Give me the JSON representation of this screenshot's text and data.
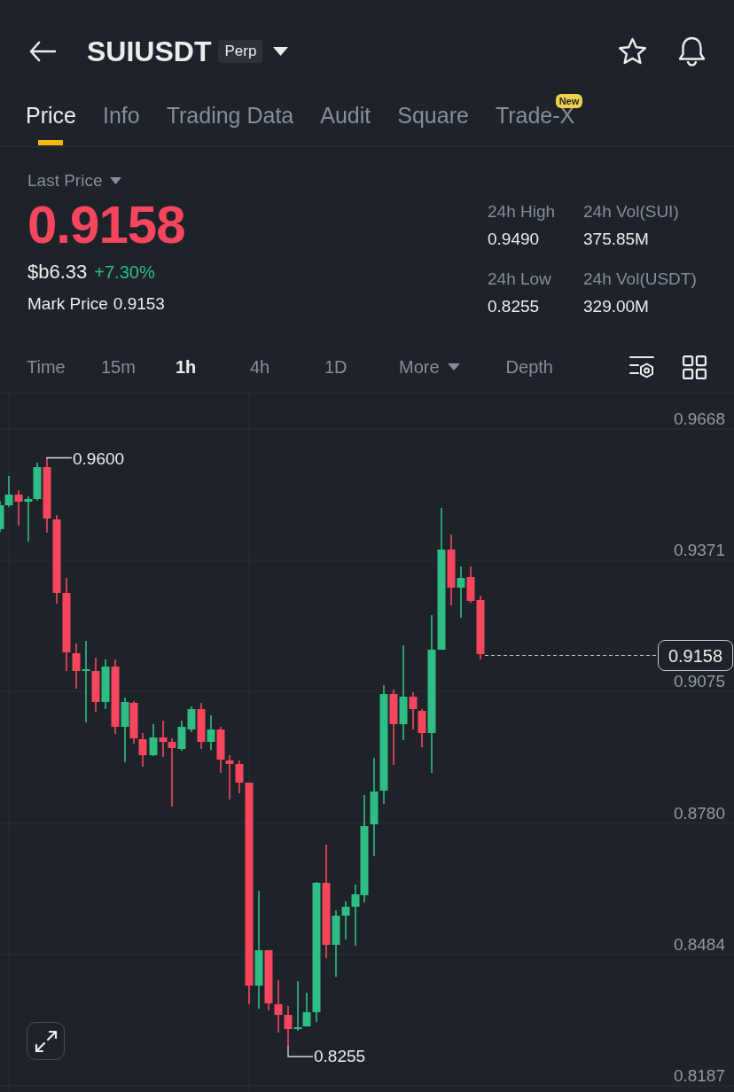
{
  "header": {
    "symbol": "SUIUSDT",
    "contract_badge": "Perp"
  },
  "tabs": [
    {
      "label": "Price",
      "selected": true
    },
    {
      "label": "Info",
      "selected": false
    },
    {
      "label": "Trading Data",
      "selected": false
    },
    {
      "label": "Audit",
      "selected": false
    },
    {
      "label": "Square",
      "selected": false
    },
    {
      "label": "Trade-X",
      "selected": false,
      "badge": "New"
    }
  ],
  "price": {
    "label": "Last Price",
    "last_price": "0.9158",
    "last_price_down": true,
    "fiat_value": "$b6.33",
    "change": "+7.30%",
    "change_up": true,
    "mark_price_label": "Mark Price",
    "mark_price": "0.9153"
  },
  "stats": [
    {
      "label": "24h High",
      "value": "0.9490"
    },
    {
      "label": "24h Vol(SUI)",
      "value": "375.85M"
    },
    {
      "label": "24h Low",
      "value": "0.8255"
    },
    {
      "label": "24h Vol(USDT)",
      "value": "329.00M"
    }
  ],
  "intervals": [
    {
      "label": "Time",
      "kind": "option",
      "selected": false
    },
    {
      "label": "15m",
      "kind": "option",
      "selected": false
    },
    {
      "label": "1h",
      "kind": "option",
      "selected": true
    },
    {
      "label": "4h",
      "kind": "option",
      "selected": false
    },
    {
      "label": "1D",
      "kind": "option",
      "selected": false
    },
    {
      "label": "More",
      "kind": "dropdown",
      "selected": false
    },
    {
      "label": "Depth",
      "kind": "option",
      "selected": false
    }
  ],
  "chart": {
    "price_axis": [
      "0.9668",
      "0.9371",
      "0.9075",
      "0.8780",
      "0.8484",
      "0.8187"
    ],
    "high_label": "0.9600",
    "low_label": "0.8255",
    "last_price_tag": "0.9158"
  }
}
